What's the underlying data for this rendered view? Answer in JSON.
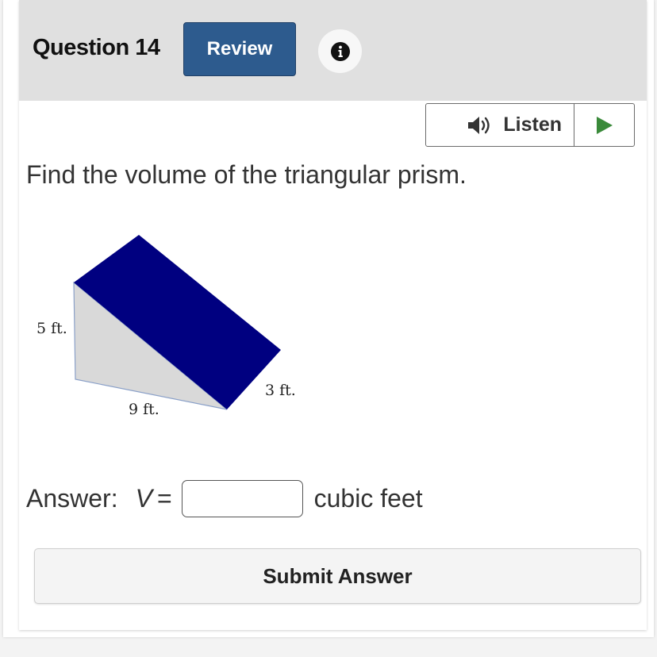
{
  "header": {
    "question_title": "Question 14",
    "review_label": "Review",
    "info_icon": "info-icon"
  },
  "listen": {
    "label": "Listen",
    "speaker_icon": "speaker-icon",
    "play_icon": "play-icon"
  },
  "question": {
    "prompt": "Find the volume of the triangular prism."
  },
  "figure": {
    "height_label": "5 ft.",
    "base_label": "9 ft.",
    "depth_label": "3 ft.",
    "colors": {
      "top_face": "#000080",
      "side_face": "#d9d9d9"
    }
  },
  "answer": {
    "label": "Answer:",
    "variable": "V",
    "equals": "=",
    "value": "",
    "unit": "cubic feet"
  },
  "submit_label": "Submit Answer",
  "colors": {
    "header_bg": "#e0e0e0",
    "review_button": "#2d5b8e",
    "play_green": "#3a8a3a"
  }
}
